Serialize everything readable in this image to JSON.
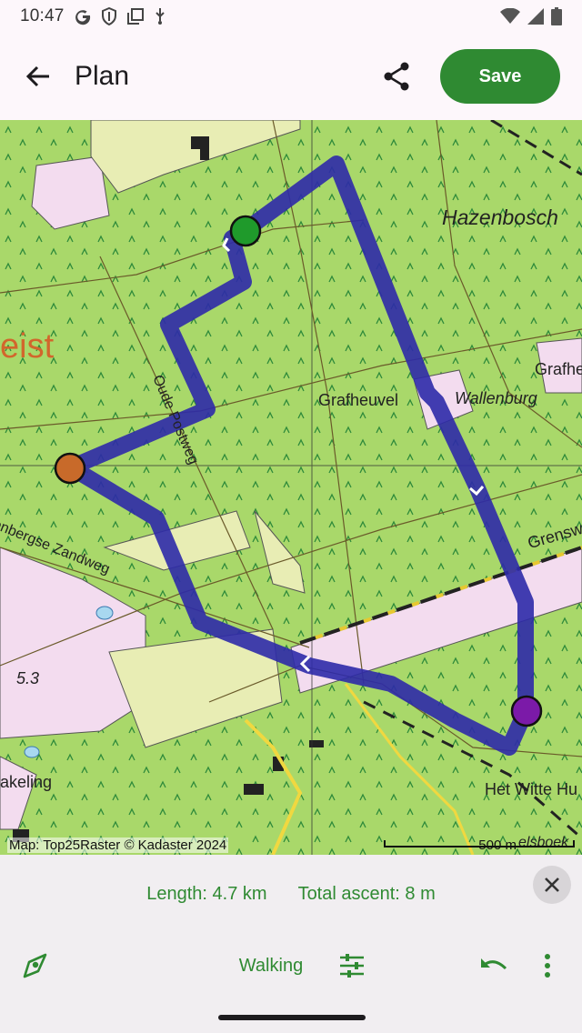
{
  "status_bar": {
    "time": "10:47",
    "left_icons": [
      "google-icon",
      "shield-icon",
      "copy-icon",
      "usb-icon"
    ],
    "right_icons": [
      "wifi-icon",
      "signal-icon",
      "battery-icon"
    ]
  },
  "app_bar": {
    "title": "Plan",
    "save_label": "Save",
    "icons": [
      "back-arrow-icon",
      "share-icon"
    ]
  },
  "map": {
    "labels": {
      "hazenbosch": "Hazenbosch",
      "grafheuvel": "Grafheuvel",
      "wallenburg": "Wallenburg",
      "grafhe": "Grafhe",
      "oude_postweg": "Oude Postweg",
      "zandweg": "enbergse Zandweg",
      "eist": "eist",
      "grensw": "Grensw",
      "elevation": "5.3",
      "kaleing": "akeling",
      "witte_huis": "Het Witte Hu",
      "velsboek": "elsboek"
    },
    "attribution": "Map: Top25Raster © Kadaster 2024",
    "scale": "500 m",
    "colors": {
      "route": "#2e2aa8",
      "start_marker": "#1f9a2b",
      "via_marker": "#c86a2a",
      "end_marker": "#7b1aa8",
      "forest": "#a9d86a"
    }
  },
  "sheet": {
    "length": "Length: 4.7 km",
    "ascent": "Total ascent: 8 m",
    "routing_mode": "Walking",
    "icons": [
      "close-icon",
      "route-pin-icon",
      "tune-icon",
      "undo-icon",
      "more-vert-icon"
    ]
  }
}
